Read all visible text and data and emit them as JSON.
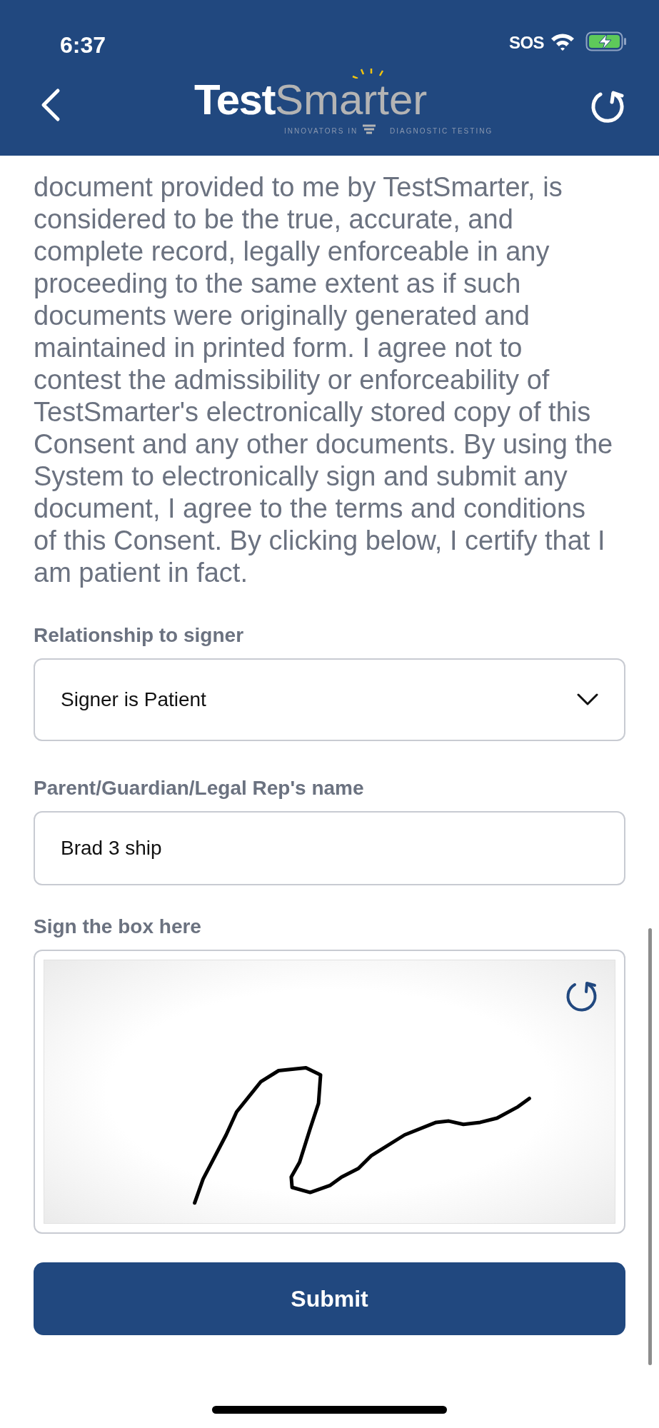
{
  "status_bar": {
    "time": "6:37",
    "carrier": "SOS"
  },
  "header": {
    "logo_bold": "Test",
    "logo_light": "Smarter",
    "tagline_left": "INNOVATORS IN",
    "tagline_right": "DIAGNOSTIC TESTING"
  },
  "consent_lines": [
    "document provided to me by TestSmarter, is",
    "considered to be the true, accurate, and",
    "complete record, legally enforceable in any",
    "proceeding to the same extent as if such",
    "documents were originally generated and",
    "maintained in printed form. I agree not to",
    "contest the admissibility or enforceability of",
    "TestSmarter's electronically stored copy of this",
    "Consent and any other documents. By using the",
    "System to electronically sign and submit any",
    "document, I agree to the terms and conditions",
    "of this Consent. By clicking below, I certify that I",
    "am patient in fact."
  ],
  "fields": [
    {
      "kind": "select",
      "label": "Relationship to signer",
      "value": "Signer is Patient"
    },
    {
      "kind": "text",
      "label": "Parent/Guardian/Legal Rep's name",
      "value": "Brad 3 ship"
    },
    {
      "kind": "signature",
      "label": "Sign the box here"
    }
  ],
  "submit": "Submit"
}
